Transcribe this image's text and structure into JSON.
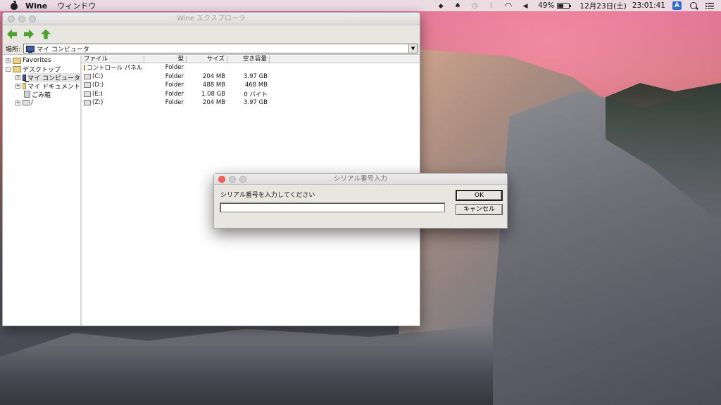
{
  "menubar": {
    "app_name": "Wine",
    "menu_window": "ウィンドウ",
    "battery_percent": "49%",
    "battery_level": 0.49,
    "date": "12月23日(土)",
    "time": "23:01:41",
    "input_method": "A"
  },
  "explorer": {
    "title": "Wine エクスプローラ",
    "address_label": "場所:",
    "address_value": "マイ コンピュータ",
    "tree": [
      {
        "label": "Favorites",
        "expander": "+"
      },
      {
        "label": "デスクトップ",
        "expander": "-"
      },
      {
        "label": "マイ コンピュータ",
        "expander": "+"
      },
      {
        "label": "マイ ドキュメント",
        "expander": "+"
      },
      {
        "label": "ごみ箱",
        "expander": ""
      },
      {
        "label": "/",
        "expander": "+"
      }
    ],
    "columns": {
      "name": "ファイル",
      "type": "型",
      "size": "サイズ",
      "free": "空き容量"
    },
    "rows": [
      {
        "name": "コントロール パネル",
        "type": "Folder",
        "size": "",
        "free": ""
      },
      {
        "name": "(C:)",
        "type": "Folder",
        "size": "204 MB",
        "free": "3.97 GB"
      },
      {
        "name": "(D:)",
        "type": "Folder",
        "size": "488 MB",
        "free": "468 MB"
      },
      {
        "name": "(E:)",
        "type": "Folder",
        "size": "1.08 GB",
        "free": "0 バイト"
      },
      {
        "name": "(Z:)",
        "type": "Folder",
        "size": "204 MB",
        "free": "3.97 GB"
      }
    ]
  },
  "dialog": {
    "title": "シリアル番号入力",
    "prompt": "シリアル番号を入力してください",
    "input_value": "",
    "ok_label": "OK",
    "cancel_label": "キャンセル"
  }
}
